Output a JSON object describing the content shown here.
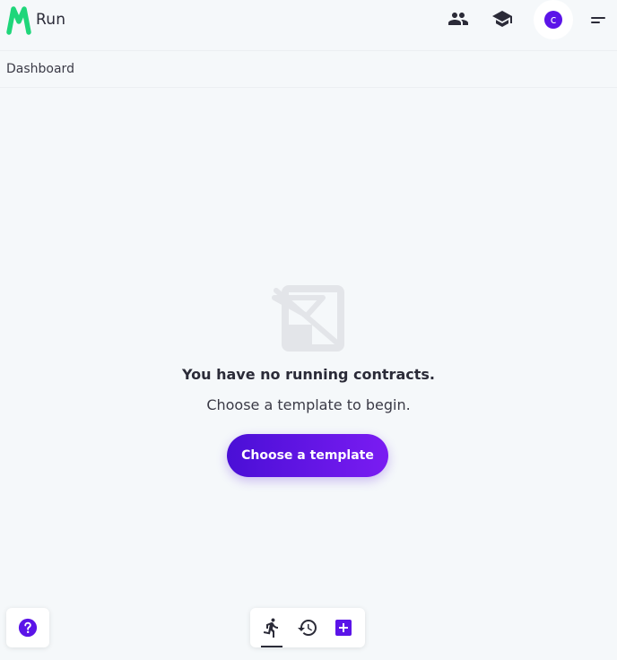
{
  "app": {
    "name": "Run",
    "brand_color": "#1fd67a",
    "accent_color": "#5b14e8"
  },
  "header": {
    "icons": [
      "people-icon",
      "graduation-cap-icon",
      "menu-icon"
    ],
    "user_initial": "c"
  },
  "breadcrumb": {
    "current": "Dashboard"
  },
  "empty_state": {
    "illustration": "no-contracts-icon",
    "title": "You have no running contracts.",
    "subtitle": "Choose a template to begin.",
    "button_label": "Choose a template"
  },
  "bottom_nav": {
    "items": [
      "running-icon",
      "history-icon",
      "add-box-icon"
    ],
    "active": "running-icon"
  },
  "help": {
    "icon": "help-icon"
  }
}
